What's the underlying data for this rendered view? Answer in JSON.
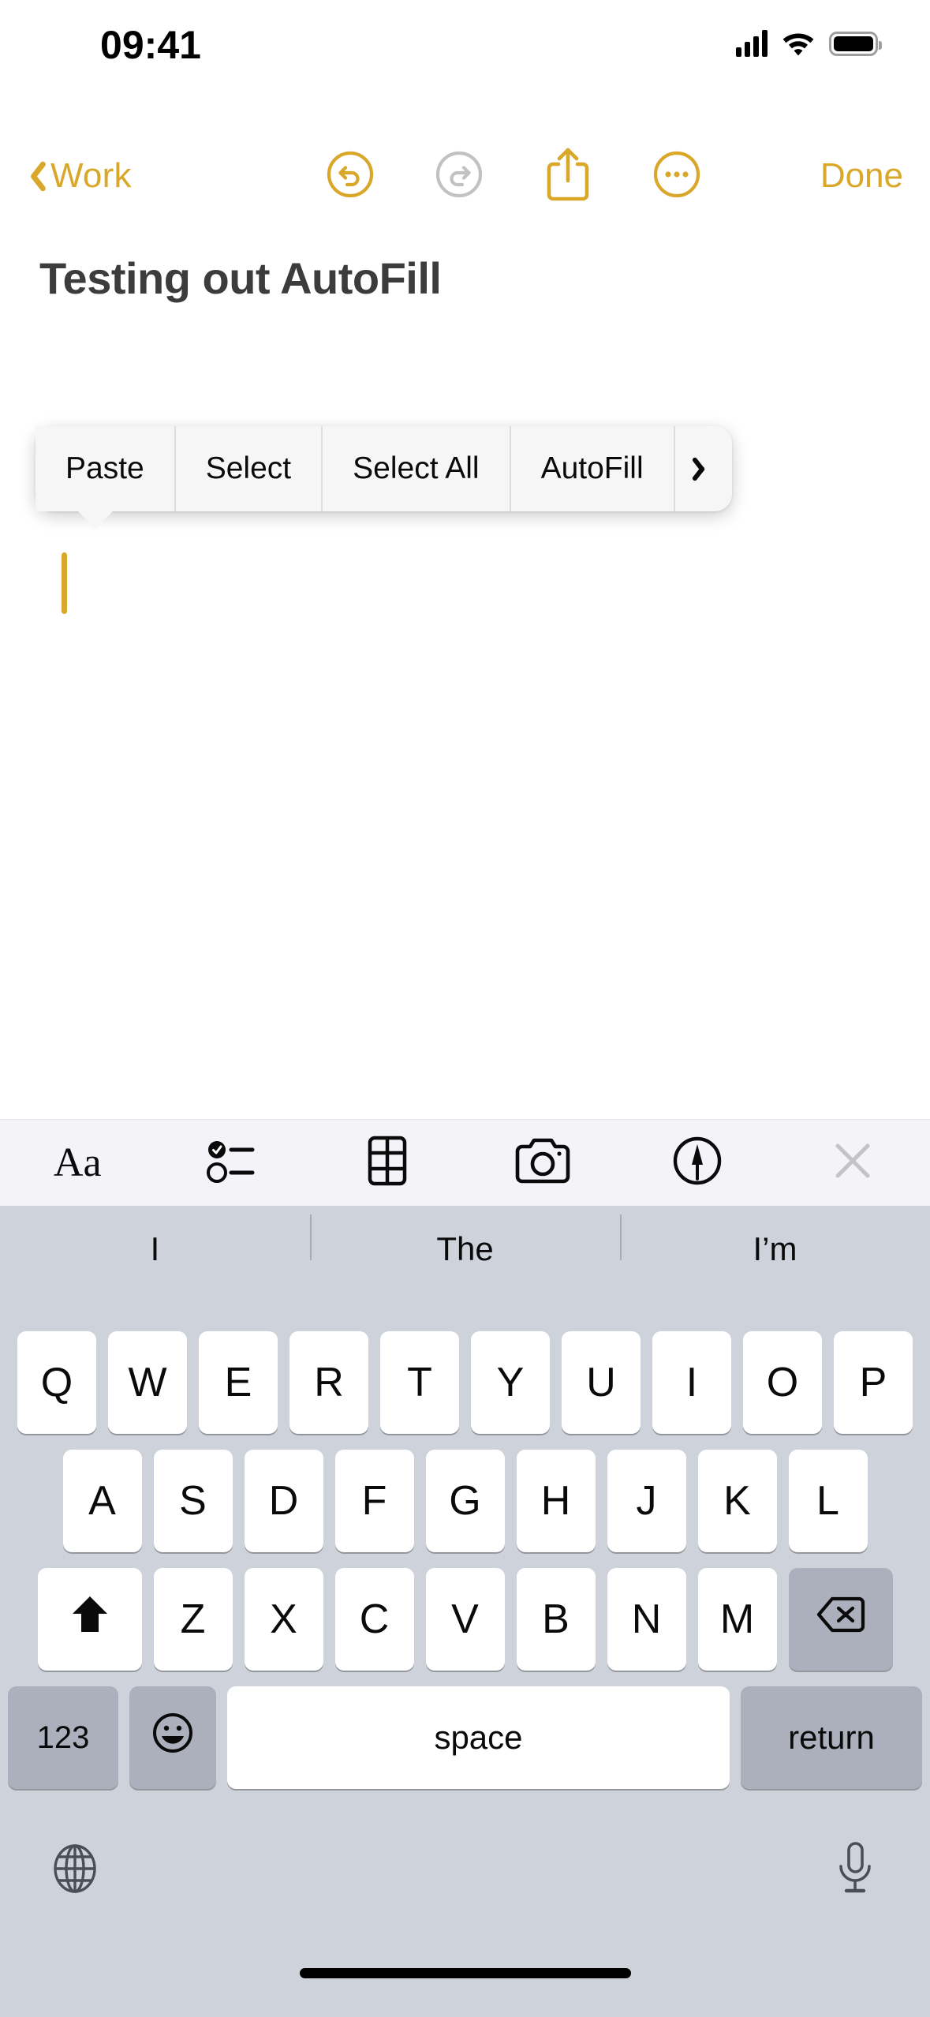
{
  "status_bar": {
    "time": "09:41",
    "cellular_icon": "cellular-bars-icon",
    "wifi_icon": "wifi-icon",
    "battery_icon": "battery-icon"
  },
  "nav_bar": {
    "back_label": "Work",
    "back_icon": "chevron-left-icon",
    "undo_icon": "undo-circle-icon",
    "undo_enabled": true,
    "redo_icon": "redo-circle-icon",
    "redo_enabled": false,
    "share_icon": "share-icon",
    "more_icon": "ellipsis-circle-icon",
    "done_label": "Done"
  },
  "note": {
    "title": "Testing out AutoFill",
    "body": "",
    "caret_visible": true
  },
  "context_menu": {
    "items": [
      {
        "label": "Paste"
      },
      {
        "label": "Select"
      },
      {
        "label": "Select All"
      },
      {
        "label": "AutoFill"
      }
    ],
    "more_icon": "chevron-right-icon"
  },
  "keyboard_toolbar": {
    "items": [
      {
        "icon": "format-aa-icon",
        "label": "Aa"
      },
      {
        "icon": "checklist-icon",
        "label": ""
      },
      {
        "icon": "table-icon",
        "label": ""
      },
      {
        "icon": "camera-icon",
        "label": ""
      },
      {
        "icon": "markup-pen-icon",
        "label": ""
      },
      {
        "icon": "close-x-icon",
        "label": ""
      }
    ]
  },
  "prediction_bar": {
    "suggestions": [
      "I",
      "The",
      "I’m"
    ]
  },
  "keyboard": {
    "row1": [
      "Q",
      "W",
      "E",
      "R",
      "T",
      "Y",
      "U",
      "I",
      "O",
      "P"
    ],
    "row2": [
      "A",
      "S",
      "D",
      "F",
      "G",
      "H",
      "J",
      "K",
      "L"
    ],
    "row3": [
      "Z",
      "X",
      "C",
      "V",
      "B",
      "N",
      "M"
    ],
    "shift_icon": "shift-up-arrow-icon",
    "backspace_icon": "backspace-delete-icon",
    "numbers_label": "123",
    "emoji_icon": "emoji-smiley-icon",
    "space_label": "space",
    "return_label": "return",
    "globe_icon": "globe-language-icon",
    "mic_icon": "microphone-dictation-icon"
  },
  "colors": {
    "accent_gold": "#D9A82A",
    "disabled_gray": "#C2C2C2",
    "keyboard_bg": "#CED2DA",
    "toolbar_bg": "#F4F3F8",
    "key_light": "#FFFFFF",
    "key_dark": "#ABB0BC",
    "title_text": "#3C3C3C"
  }
}
